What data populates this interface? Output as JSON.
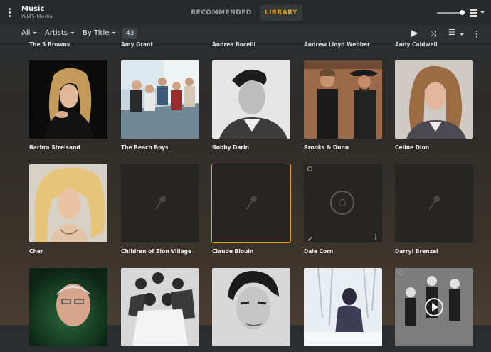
{
  "header": {
    "library_title": "Music",
    "library_server": "WMS-Media",
    "tabs": [
      {
        "label": "RECOMMENDED",
        "active": false
      },
      {
        "label": "LIBRARY",
        "active": true
      }
    ],
    "accent_color": "#e5a00d",
    "view_size_slider": 1.0
  },
  "filter_bar": {
    "filter_label": "All",
    "type_label": "Artists",
    "sort_label": "By Title",
    "item_count": "43"
  },
  "partial_row": [
    "The 3 Browns",
    "Amy Grant",
    "Andrea Bocelli",
    "Andrew Lloyd Webber",
    "Andy Caldwell"
  ],
  "artists": [
    {
      "name": "Barbra Streisand",
      "art": "photo"
    },
    {
      "name": "The Beach Boys",
      "art": "photo"
    },
    {
      "name": "Bobby Darin",
      "art": "photo"
    },
    {
      "name": "Brooks & Dunn",
      "art": "photo"
    },
    {
      "name": "Celine Dion",
      "art": "photo"
    },
    {
      "name": "Cher",
      "art": "photo"
    },
    {
      "name": "Children of Zion Village",
      "art": "placeholder"
    },
    {
      "name": "Claude Blouin",
      "art": "placeholder",
      "selected": true
    },
    {
      "name": "Dale Corn",
      "art": "placeholder-hover"
    },
    {
      "name": "Darryl Brenzel",
      "art": "placeholder"
    },
    {
      "name": "",
      "art": "photo"
    },
    {
      "name": "",
      "art": "photo"
    },
    {
      "name": "",
      "art": "photo"
    },
    {
      "name": "",
      "art": "photo"
    },
    {
      "name": "",
      "art": "photo-hover"
    }
  ]
}
